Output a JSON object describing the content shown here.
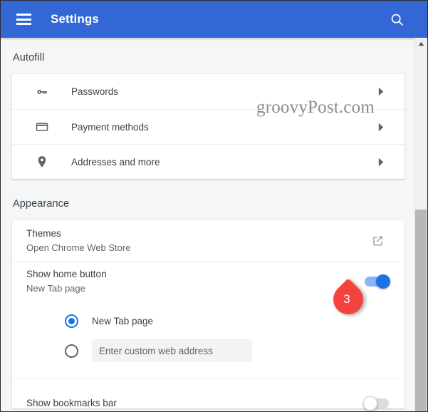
{
  "appbar": {
    "title": "Settings",
    "menu_icon": "hamburger-menu-icon",
    "search_icon": "search-icon"
  },
  "sections": [
    {
      "title": "Autofill",
      "rows": [
        {
          "icon": "key-icon",
          "label": "Passwords",
          "chevron": "chevron-right-icon"
        },
        {
          "icon": "credit-card-icon",
          "label": "Payment methods",
          "chevron": "chevron-right-icon"
        },
        {
          "icon": "location-pin-icon",
          "label": "Addresses and more",
          "chevron": "chevron-right-icon"
        }
      ]
    },
    {
      "title": "Appearance",
      "themes": {
        "primary": "Themes",
        "secondary": "Open Chrome Web Store",
        "action_icon": "open-in-new-icon"
      },
      "home_button": {
        "primary": "Show home button",
        "secondary": "New Tab page",
        "toggle_state": "on",
        "toggle_on_track_color": "#8ab4f8",
        "toggle_on_knob_color": "#1a73e8"
      },
      "home_options": [
        {
          "label": "New Tab page",
          "selected": true
        },
        {
          "label": "",
          "placeholder": "Enter custom web address",
          "value": "",
          "selected": false
        }
      ],
      "bookmarks_bar": {
        "primary": "Show bookmarks bar",
        "toggle_state": "off"
      }
    }
  ],
  "callout": {
    "number": "3",
    "color": "#f4433c"
  },
  "watermark": {
    "text": "groovyPost.com"
  },
  "scrollbar": {
    "up_arrow_icon": "scroll-up-arrow-icon",
    "thumb_color": "#b7b7b7"
  },
  "theme": {
    "appbar_color": "#3367d6",
    "page_background": "#f5f6f7",
    "card_background": "#ffffff",
    "accent_blue": "#1a73e8"
  }
}
